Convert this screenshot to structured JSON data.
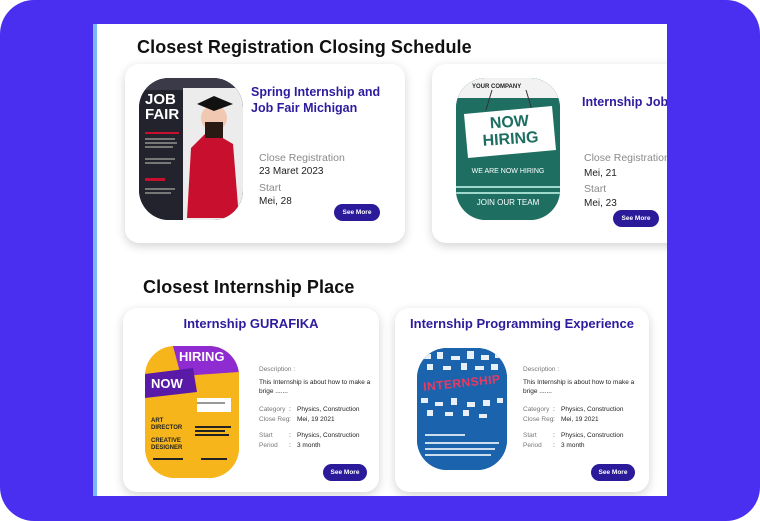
{
  "registration_section": {
    "title": "Closest Registration Closing Schedule",
    "cards": [
      {
        "title": "Spring Internship and Job Fair Michigan",
        "close_label": "Close Registration",
        "close_date": "23 Maret 2023",
        "start_label": "Start",
        "start_date": "Mei, 28",
        "button": "See More",
        "poster": {
          "headline_top": "JOB",
          "headline_bottom": "FAIR"
        }
      },
      {
        "title": "Internship Job Team",
        "close_label": "Close Registration",
        "close_date": "Mei, 21",
        "start_label": "Start",
        "start_date": "Mei, 23",
        "button": "See More",
        "poster": {
          "brand": "YOUR COMPANY",
          "sign_top": "NOW",
          "sign_bottom": "HIRING",
          "sub": "WE ARE NOW HIRING",
          "cta": "JOIN OUR TEAM"
        }
      }
    ]
  },
  "internship_section": {
    "title": "Closest Internship Place",
    "cards": [
      {
        "title": "Internship GURAFIKA",
        "desc_label": "Description :",
        "desc": "This Internship is about how to make a brige .......",
        "category_label": "Category",
        "category": "Physics, Construction",
        "close_label": "Close Reg",
        "close": "Mei, 19 2021",
        "start_label": "Start",
        "start": "Physics, Construction",
        "period_label": "Period",
        "period": "3 month",
        "button": "See More",
        "poster": {
          "top": "HIRING",
          "mid": "NOW",
          "role1": "ART DIRECTOR",
          "role2": "CREATIVE DESIGNER"
        }
      },
      {
        "title": "Internship Programming Experience",
        "desc_label": "Description :",
        "desc": "This Internship is about how to make a brige .......",
        "category_label": "Category",
        "category": "Physics, Construction",
        "close_label": "Close Reg",
        "close": "Mei, 19 2021",
        "start_label": "Start",
        "start": "Physics, Construction",
        "period_label": "Period",
        "period": "3 month",
        "button": "See More",
        "poster": {
          "word": "INTERNSHIP"
        }
      }
    ]
  },
  "colors": {
    "frame": "#4a2ff0",
    "accent": "#2d1b9e",
    "button": "#2b1a9a"
  }
}
